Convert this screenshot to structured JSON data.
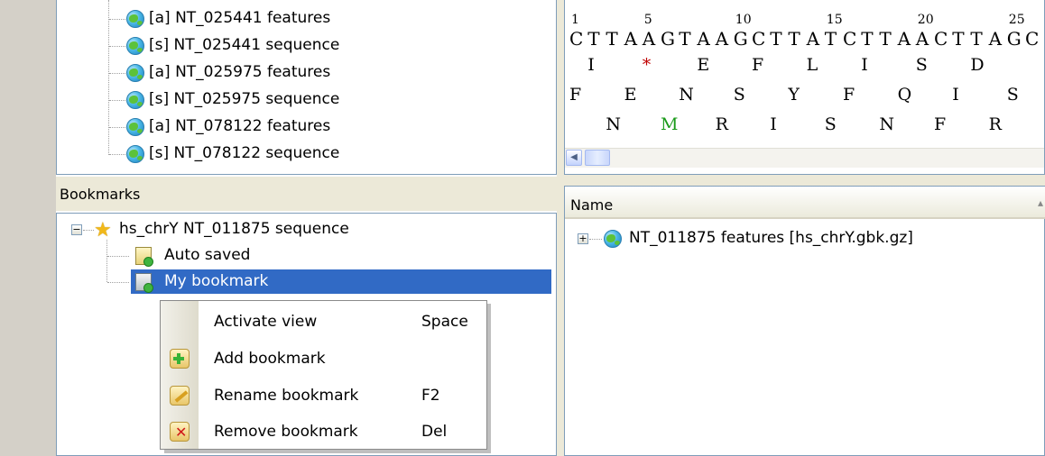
{
  "project_tree": {
    "items": [
      {
        "label": "[a] NT_025441 features"
      },
      {
        "label": "[s] NT_025441 sequence"
      },
      {
        "label": "[a] NT_025975 features"
      },
      {
        "label": "[s] NT_025975 sequence"
      },
      {
        "label": "[a] NT_078122 features"
      },
      {
        "label": "[s] NT_078122 sequence"
      }
    ]
  },
  "sequence_view": {
    "ruler": [
      "1",
      "5",
      "10",
      "15",
      "20",
      "25"
    ],
    "sequence": "CTTAAGTAAGCTTATCTTAACTTAGC",
    "frame1": [
      "I",
      "*",
      "E",
      "F",
      "L",
      "I",
      "S",
      "D"
    ],
    "frame2": [
      "F",
      "E",
      "N",
      "S",
      "Y",
      "F",
      "Q",
      "I",
      "S"
    ],
    "frame3": [
      "N",
      "M",
      "R",
      "I",
      "S",
      "N",
      "F",
      "R"
    ],
    "stop_color": "#c00000",
    "start_color": "#1a9a1a"
  },
  "bookmarks": {
    "title": "Bookmarks",
    "root_label": "hs_chrY NT_011875 sequence",
    "children": [
      {
        "label": "Auto saved"
      },
      {
        "label": "My bookmark"
      }
    ]
  },
  "object_list": {
    "column_name": "Name",
    "items": [
      {
        "label": "NT_011875 features [hs_chrY.gbk.gz]"
      }
    ]
  },
  "context_menu": {
    "items": [
      {
        "label": "Activate view",
        "shortcut": "Space",
        "icon": "none"
      },
      {
        "label": "Add bookmark",
        "shortcut": "",
        "icon": "add-bookmark-icon"
      },
      {
        "label": "Rename bookmark",
        "shortcut": "F2",
        "icon": "rename-bookmark-icon"
      },
      {
        "label": "Remove bookmark",
        "shortcut": "Del",
        "icon": "remove-bookmark-icon"
      }
    ]
  },
  "colors": {
    "selection": "#316ac5",
    "panel": "#ece9d8",
    "border": "#7f9db9"
  }
}
